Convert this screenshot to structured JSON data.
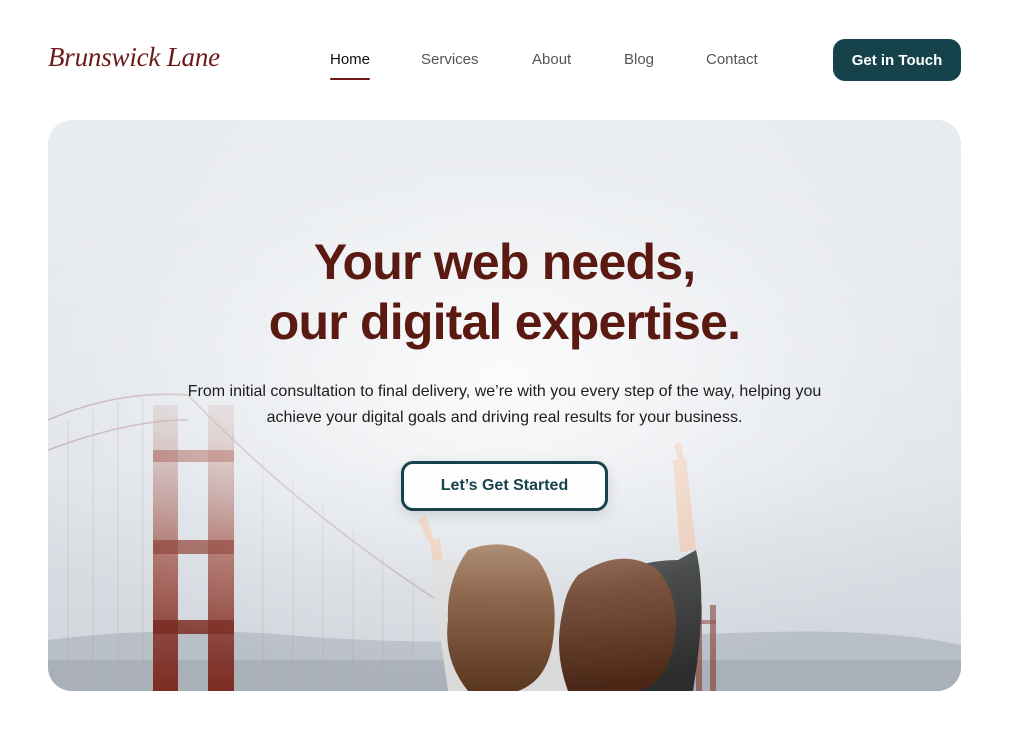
{
  "header": {
    "logo": "Brunswick Lane",
    "nav": [
      {
        "label": "Home",
        "active": true
      },
      {
        "label": "Services",
        "active": false
      },
      {
        "label": "About",
        "active": false
      },
      {
        "label": "Blog",
        "active": false
      },
      {
        "label": "Contact",
        "active": false
      }
    ],
    "cta_label": "Get in Touch"
  },
  "hero": {
    "title_line1": "Your web needs,",
    "title_line2": "our digital expertise.",
    "subtitle": "From initial consultation to final delivery, we’re with you every step of the way, helping you achieve your digital goals and driving real results for your business.",
    "cta_label": "Let’s Get Started"
  },
  "colors": {
    "brand": "#6b1a1a",
    "accent": "#16434b",
    "title": "#5a1a12"
  }
}
